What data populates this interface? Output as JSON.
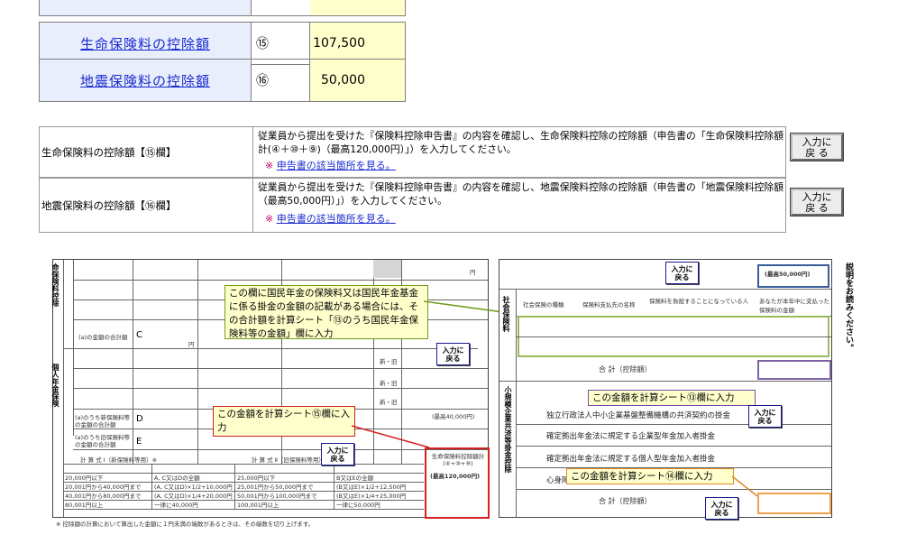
{
  "summary": {
    "rows": [
      {
        "label": "生命保険料の控除額",
        "num": "⑮",
        "value": "107,500"
      },
      {
        "label": "地震保険料の控除額",
        "num": "⑯",
        "value": "50,000"
      }
    ]
  },
  "instructions": [
    {
      "label": "生命保険料の控除額【⑮欄】",
      "text": "従業員から提出を受けた『保険料控除申告書』の内容を確認し、生命保険料控除の控除額（申告書の「生命保険料控除額計(④＋⑩＋⑨)（最高120,000円）」）を入力してください。",
      "mark": "※",
      "link": "申告書の該当箇所を見る。",
      "button": [
        "入力に",
        "戻 る"
      ]
    },
    {
      "label": "地震保険料の控除額【⑯欄】",
      "text": "従業員から提出を受けた『保険料控除申告書』の内容を確認し、地震保険料控除の控除額（申告書の「地震保険料控除額（最高50,000円）」）を入力してください。",
      "mark": "※",
      "link": "申告書の該当箇所を見る。",
      "button": [
        "入力に",
        "戻 る"
      ]
    }
  ],
  "form": {
    "left_vertical": "命保険料控除",
    "left_vertical2": "個人年金保険",
    "callouts": {
      "green": "この欄に国民年金の保険料又は国民年金基金に係る掛金の金額の記載がある場合には、その合計額を計算シート「⑬のうち国民年金保険料等の金額」欄に入力",
      "red": "この金額を計算シート⑮欄に入力",
      "purple": "この金額を計算シート⑬欄に入力",
      "orange": "この金額を計算シート⑭欄に入力"
    },
    "left_labels": {
      "sum_c": "(a)の金額の合計額",
      "c": "C",
      "d_label": "(a)のうち新保険料等の金額の合計額",
      "d": "D",
      "e_label": "(a)のうち旧保険料等の金額の合計額",
      "e": "E",
      "total_label": "生命保険料控除額計(④+⑩+⑨)",
      "total_max": "(最高120,000円)",
      "calc1": "計 算 式 Ⅰ（新保険料等用）※",
      "calc2": "計 算 式 Ⅱ（旧保険料等用）※",
      "calc_rows": [
        [
          "20,000円以下",
          "A, C又はDの全額",
          "25,000円以下",
          "B又はEの全額"
        ],
        [
          "20,001円から40,000円まで",
          "(A, C又はD)×1/2+10,000円",
          "25,001円から50,000円まで",
          "(B又はE)×1/2+12,500円"
        ],
        [
          "40,001円から80,000円まで",
          "(A, C又はD)×1/4+20,000円",
          "50,001円から100,000円まで",
          "(B又はE)×1/4+25,000円"
        ],
        [
          "80,001円以上",
          "一律に40,000円",
          "100,001円以上",
          "一律に50,000円"
        ]
      ],
      "footnote": "※ 控除額の計算において算出した金額に１円未満の端数があるときは、その端数を切り上げます。",
      "new_old": "新・旧",
      "yen": "円",
      "max_40000": "(最高40,000円)"
    },
    "right_labels": {
      "max_50000": "(最高50,000円)",
      "shakai_vertical": "社会保険料",
      "shokibo_vertical": "小規模企業共済等掛金控除",
      "header": [
        "社会保険の種類",
        "保険料支払先の名称",
        "保険料を負担することになっている人",
        "あなたが本年中に支払った保険料の金額"
      ],
      "total": "合 計（控除額）",
      "items": [
        "独立行政法人中小企業基盤整備機構の共済契約の掛金",
        "確定拠出年金法に規定する企業型年金加入者掛金",
        "確定拠出年金法に規定する個人型年金加入者掛金",
        "心身障害者扶養共済制度に関する契約の掛金"
      ],
      "total2": "合 計（控除額）",
      "right_side": "説明をお読みください。"
    },
    "small_button": [
      "入力に",
      "戻る"
    ]
  }
}
